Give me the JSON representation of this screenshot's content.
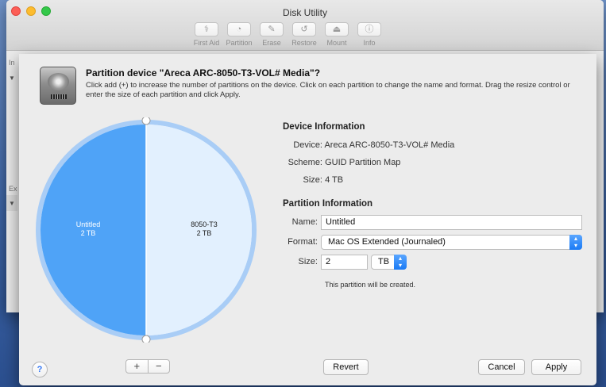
{
  "window": {
    "title": "Disk Utility"
  },
  "toolbar": {
    "items": [
      {
        "label": "First Aid",
        "icon": "stethoscope-icon",
        "glyph": "⚕"
      },
      {
        "label": "Partition",
        "icon": "partition-icon",
        "glyph": "◔"
      },
      {
        "label": "Erase",
        "icon": "erase-icon",
        "glyph": "✎"
      },
      {
        "label": "Restore",
        "icon": "restore-icon",
        "glyph": "↺"
      },
      {
        "label": "Mount",
        "icon": "mount-icon",
        "glyph": "⏏"
      },
      {
        "label": "Info",
        "icon": "info-icon",
        "glyph": "ⓘ"
      }
    ]
  },
  "sidebar": {
    "internal_label": "In",
    "external_label": "Ex"
  },
  "sheet": {
    "heading": "Partition device \"Areca ARC-8050-T3-VOL# Media\"?",
    "description": "Click add (+) to increase the number of partitions on the device. Click on each partition to change the name and format. Drag the resize control or enter the size of each partition and click Apply."
  },
  "pie": {
    "partitions": [
      {
        "name": "Untitled",
        "size": "2 TB",
        "fraction": 0.5,
        "color": "#4fa3f7",
        "selected": true
      },
      {
        "name": "8050-T3",
        "size": "2 TB",
        "fraction": 0.5,
        "color": "#e2f0fe",
        "selected": false
      }
    ]
  },
  "device_info": {
    "title": "Device Information",
    "device_label": "Device:",
    "device_value": "Areca ARC-8050-T3-VOL# Media",
    "scheme_label": "Scheme:",
    "scheme_value": "GUID Partition Map",
    "size_label": "Size:",
    "size_value": "4 TB"
  },
  "partition_info": {
    "title": "Partition Information",
    "name_label": "Name:",
    "name_value": "Untitled",
    "format_label": "Format:",
    "format_value": "Mac OS Extended (Journaled)",
    "size_label": "Size:",
    "size_value": "2",
    "size_unit": "TB",
    "note": "This partition will be created."
  },
  "buttons": {
    "help": "?",
    "add": "+",
    "remove": "−",
    "revert": "Revert",
    "cancel": "Cancel",
    "apply": "Apply"
  },
  "colors": {
    "accent": "#1a7af5",
    "selected_partition": "#4fa3f7",
    "other_partition": "#e2f0fe"
  }
}
